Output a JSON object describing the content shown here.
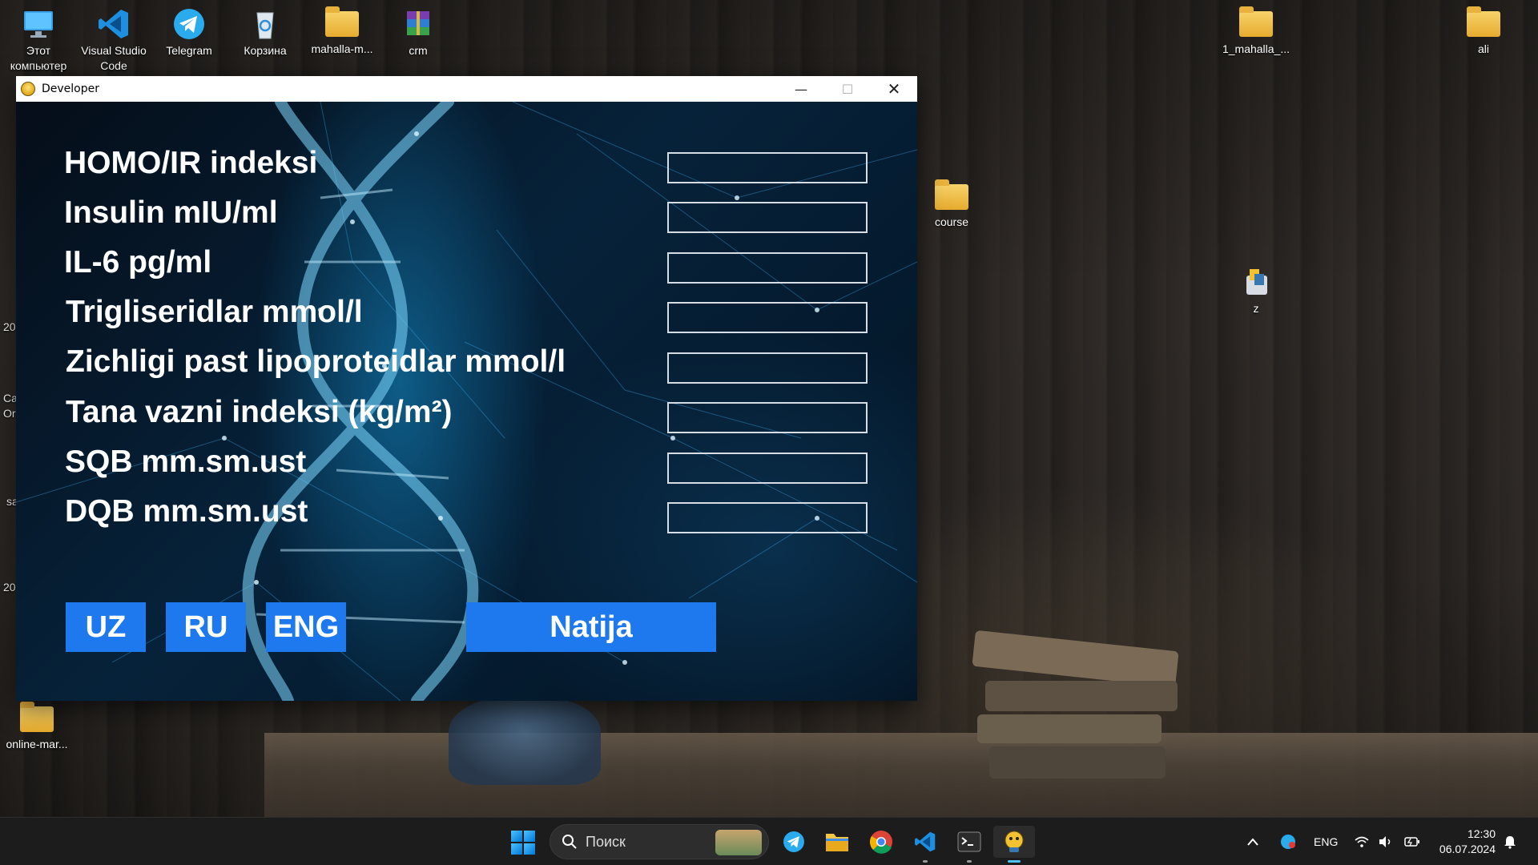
{
  "desktop": {
    "icons": [
      {
        "label": "Этот\nкомпьютер"
      },
      {
        "label": "Visual Studio\nCode"
      },
      {
        "label": "Telegram"
      },
      {
        "label": "Корзина"
      },
      {
        "label": "mahalla-m..."
      },
      {
        "label": "crm"
      },
      {
        "label": "1_mahalla_..."
      },
      {
        "label": "ali"
      },
      {
        "label": "course"
      },
      {
        "label": "z"
      },
      {
        "label": "online-mar..."
      }
    ],
    "partial_edge_text": [
      "20",
      "Ca",
      "Or",
      "sa",
      "20"
    ]
  },
  "window": {
    "title": "Developer",
    "controls": {
      "minimize": "—",
      "maximize": "☐",
      "close": "✕"
    },
    "fields": [
      {
        "label": "HOMO/IR indeksi",
        "value": ""
      },
      {
        "label": "Insulin mIU/ml",
        "value": ""
      },
      {
        "label": "IL-6 pg/ml",
        "value": ""
      },
      {
        "label": "Trigliseridlar mmol/l",
        "value": ""
      },
      {
        "label": "Zichligi past lipoproteidlar mmol/l",
        "value": ""
      },
      {
        "label": "Tana vazni indeksi (kg/m²)",
        "value": ""
      },
      {
        "label": "SQB mm.sm.ust",
        "value": ""
      },
      {
        "label": "DQB mm.sm.ust",
        "value": ""
      }
    ],
    "language_buttons": [
      "UZ",
      "RU",
      "ENG"
    ],
    "result_button": "Natija"
  },
  "taskbar": {
    "search_placeholder": "Поиск",
    "apps": [
      "telegram-icon",
      "file-explorer-icon",
      "chrome-icon",
      "vscode-icon",
      "terminal-icon",
      "python-app-icon"
    ],
    "tray": {
      "language": "ENG",
      "time": "12:30",
      "date": "06.07.2024"
    }
  },
  "colors": {
    "button_blue": "#1e78ee",
    "field_border": "#d6dde5",
    "taskbar_bg": "#1c1c1c",
    "accent": "#4cc2ff"
  }
}
